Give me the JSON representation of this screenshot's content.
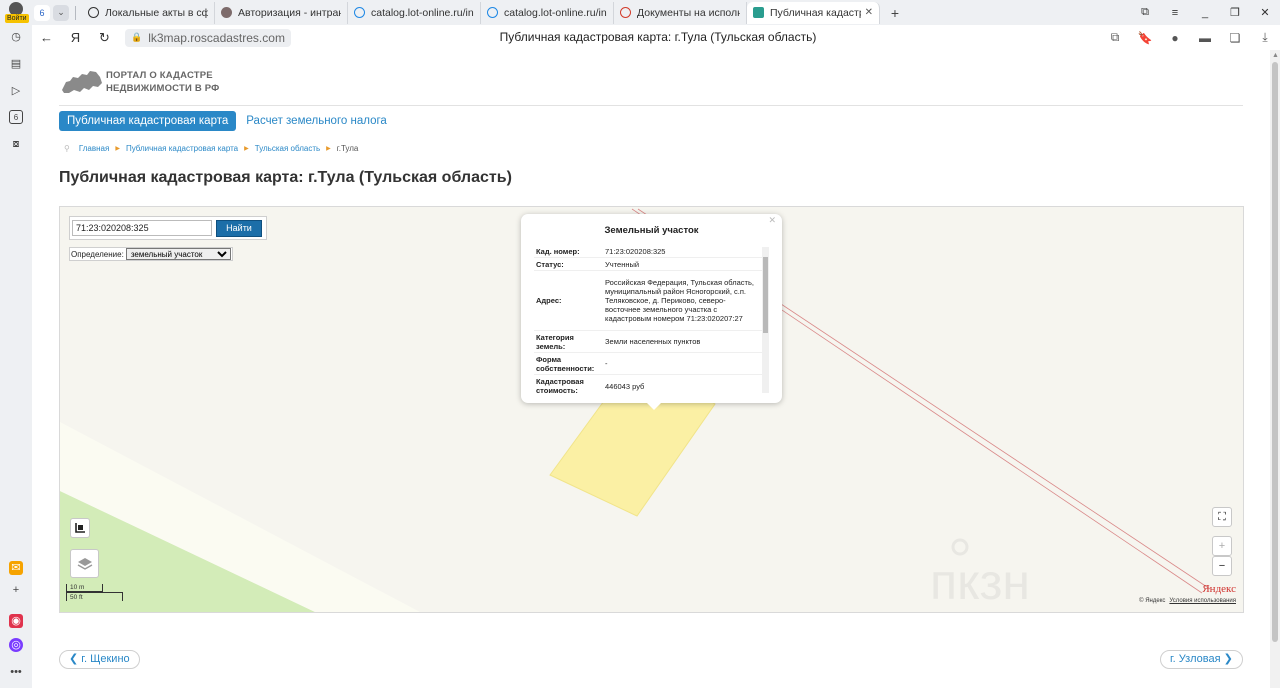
{
  "browser": {
    "profile_badge": "Войти",
    "tab_count": "6",
    "tabs": [
      {
        "title": "Локальные акты в сфере",
        "favicon": "globe"
      },
      {
        "title": "Авторизация - интранет",
        "favicon": "camera"
      },
      {
        "title": "catalog.lot-online.ru/inde",
        "favicon": "circle"
      },
      {
        "title": "catalog.lot-online.ru/inde",
        "favicon": "circle"
      },
      {
        "title": "Документы на исполнен",
        "favicon": "doc"
      },
      {
        "title": "Публичная кадастров",
        "favicon": "cadastre",
        "active": true
      }
    ],
    "url": "lk3map.roscadastres.com",
    "page_title": "Публичная кадастровая карта: г.Тула (Тульская область)"
  },
  "site": {
    "logo_line1": "ПОРТАЛ О КАДАСТРЕ",
    "logo_line2": "НЕДВИЖИМОСТИ В РФ",
    "menu": {
      "active": "Публичная кадастровая карта",
      "link": "Расчет земельного налога"
    },
    "breadcrumb": [
      "Главная",
      "Публичная кадастровая карта",
      "Тульская область",
      "г.Тула"
    ],
    "heading": "Публичная кадастровая карта: г.Тула (Тульская область)"
  },
  "map": {
    "search_value": "71:23:020208:325",
    "search_button": "Найти",
    "definition_label": "Определение:",
    "definition_value": "земельный участок",
    "popup": {
      "title": "Земельный участок",
      "rows": [
        {
          "key": "Кад. номер:",
          "value": "71:23:020208:325"
        },
        {
          "key": "Статус:",
          "value": "Учтенный"
        },
        {
          "key": "Адрес:",
          "value": "Российская Федерация, Тульская область, муниципальный район Ясногорский, с.п. Теляковское, д. Периково, северо-восточнее земельного участка с кадастровым номером 71:23:020207:27"
        },
        {
          "key": "Категория земель:",
          "value": "Земли населенных пунктов"
        },
        {
          "key": "Форма собственности:",
          "value": "-"
        },
        {
          "key": "Кадастровая стоимость:",
          "value": "446043 руб"
        }
      ]
    },
    "scale_top": "10 m",
    "scale_bottom": "50 ft",
    "yandex_logo": "Яндекс",
    "copyright": "© Яндекс",
    "terms": "Условия использования",
    "zoom_in": "+",
    "zoom_out": "−",
    "watermark": "пкзн"
  },
  "pager": {
    "prev": "г. Щекино",
    "next": "г. Узловая"
  }
}
